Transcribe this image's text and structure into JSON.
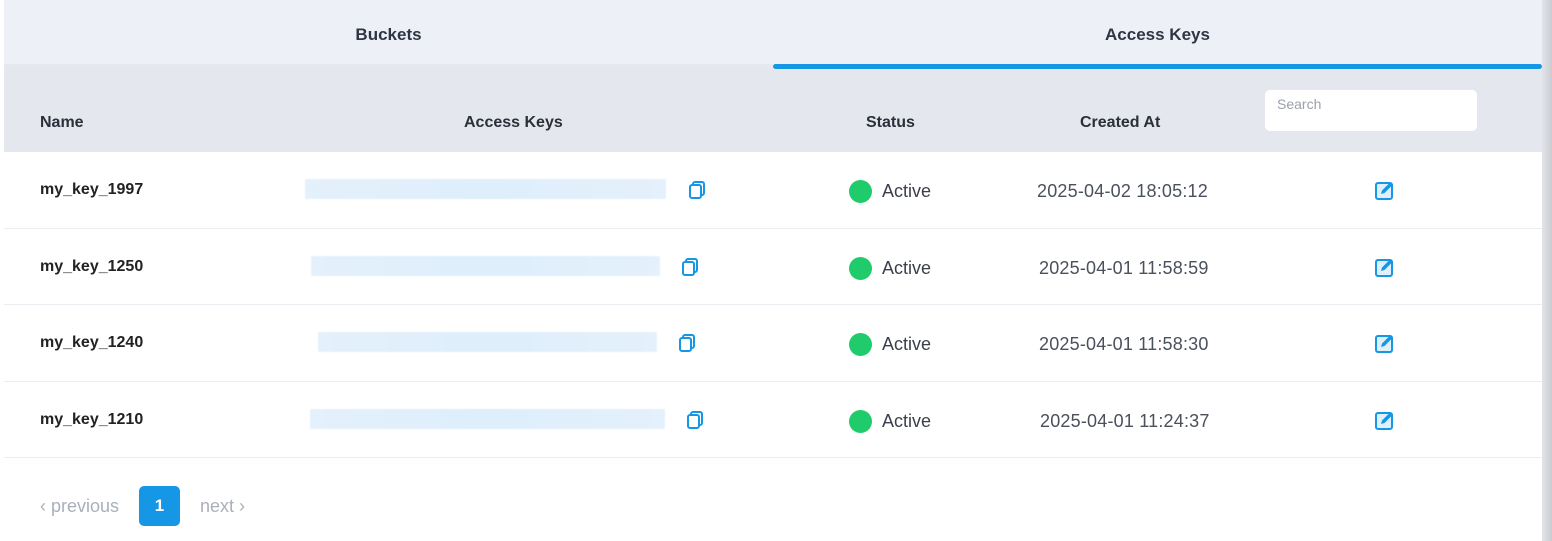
{
  "tabs": [
    {
      "label": "Buckets",
      "active": false
    },
    {
      "label": "Access Keys",
      "active": true
    }
  ],
  "table": {
    "headers": {
      "name": "Name",
      "access_keys": "Access Keys",
      "status": "Status",
      "created_at": "Created At"
    },
    "search_placeholder": "Search",
    "rows": [
      {
        "name": "my_key_1997",
        "status": "Active",
        "created_at": "2025-04-02 18:05:12"
      },
      {
        "name": "my_key_1250",
        "status": "Active",
        "created_at": "2025-04-01 11:58:59"
      },
      {
        "name": "my_key_1240",
        "status": "Active",
        "created_at": "2025-04-01 11:58:30"
      },
      {
        "name": "my_key_1210",
        "status": "Active",
        "created_at": "2025-04-01 11:24:37"
      }
    ]
  },
  "pagination": {
    "previous": "‹ previous",
    "current": "1",
    "next": "next ›"
  },
  "colors": {
    "accent": "#1597e5",
    "status_active": "#1fcb6a",
    "header_bg": "#e5e7ee",
    "tabs_bg": "#edf1f7"
  },
  "icons": {
    "copy": "copy-icon",
    "edit": "edit-icon",
    "status": "status-dot"
  }
}
